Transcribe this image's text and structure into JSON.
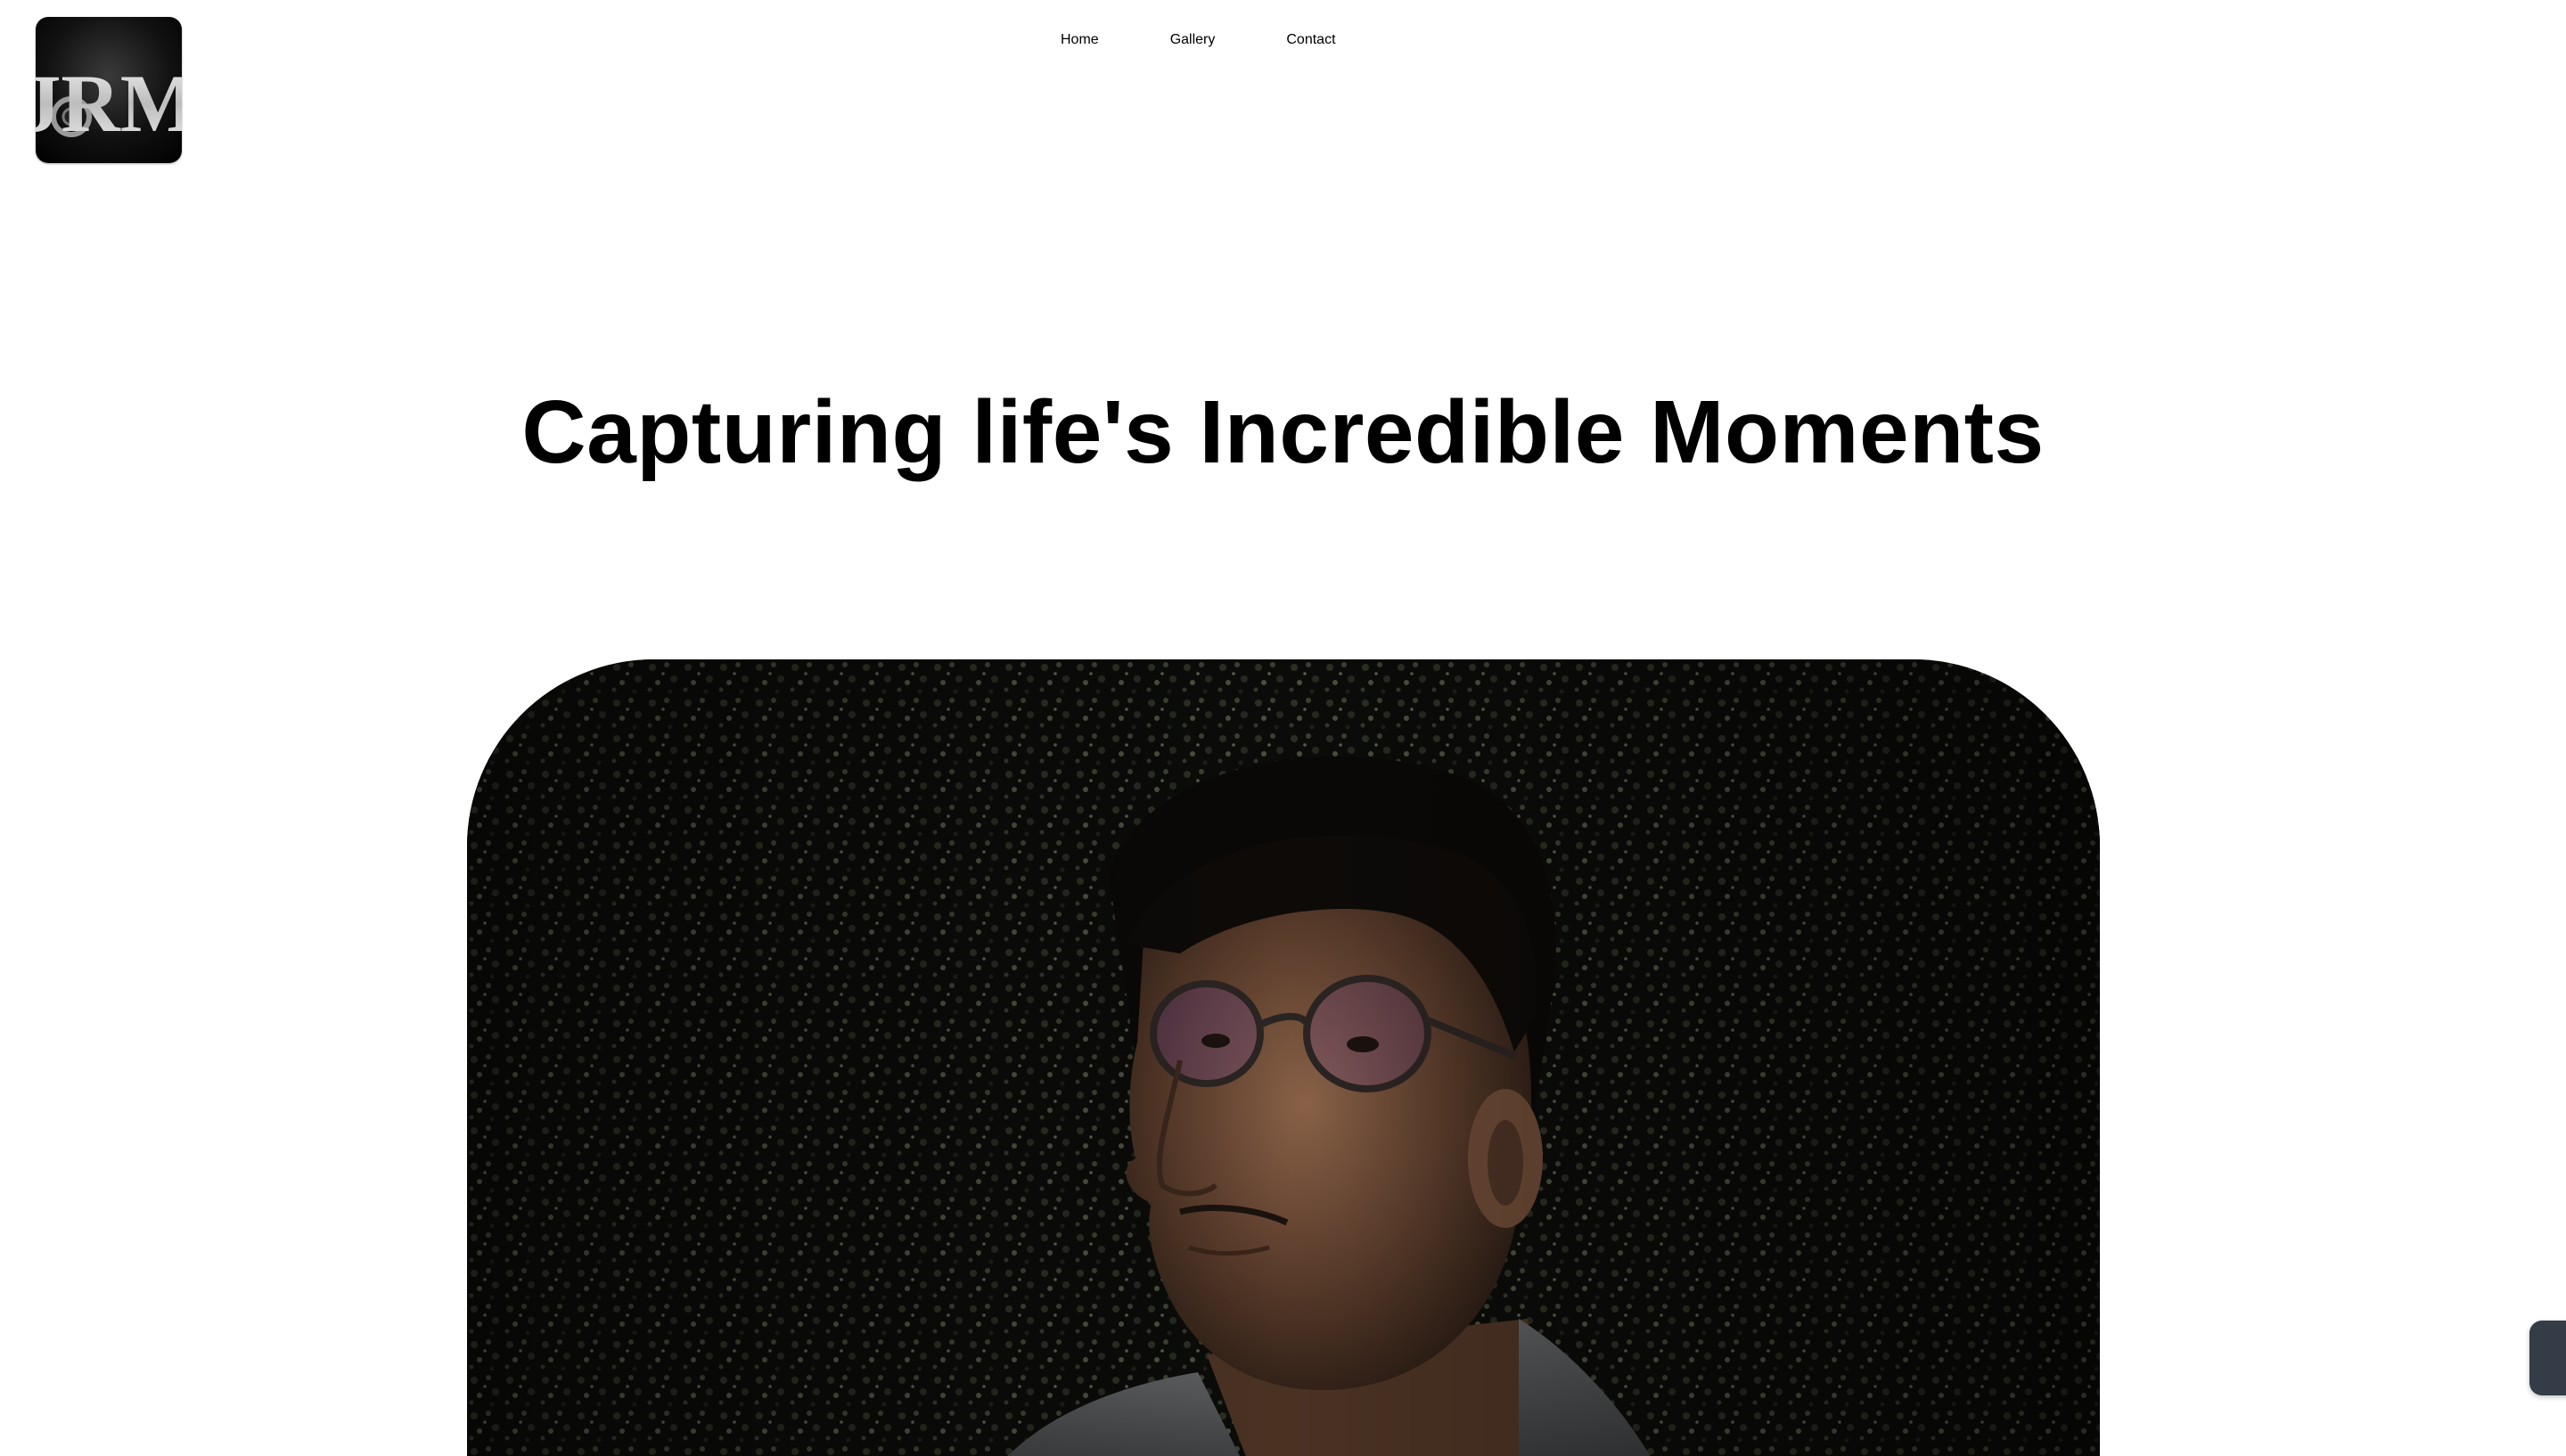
{
  "logo": {
    "alt": "JRM",
    "text": "JRM"
  },
  "nav": {
    "items": [
      {
        "label": "Home"
      },
      {
        "label": "Gallery"
      },
      {
        "label": "Contact"
      }
    ]
  },
  "hero": {
    "title": "Capturing life's Incredible Moments",
    "image_alt": "Portrait of a man with glasses looking upward in low light"
  },
  "colors": {
    "nav_text": "#7a7a7a",
    "title_text": "#000000",
    "background": "#ffffff",
    "widget": "#333c47"
  },
  "icons": [
    "logo-mark",
    "chat-widget-icon"
  ]
}
